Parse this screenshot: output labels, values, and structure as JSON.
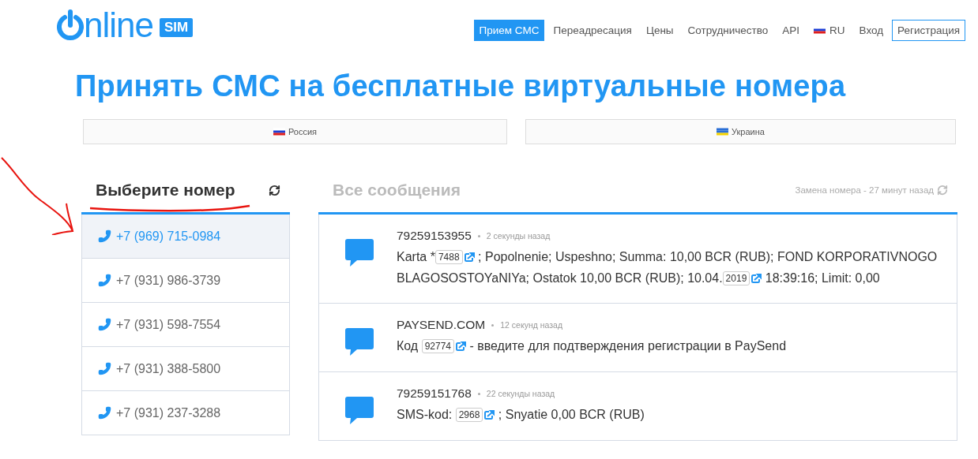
{
  "logo": {
    "text": "nline",
    "badge": "SIM"
  },
  "nav": [
    {
      "label": "Прием СМС",
      "kind": "link",
      "selected": true
    },
    {
      "label": "Переадресация",
      "kind": "link",
      "selected": false
    },
    {
      "label": "Цены",
      "kind": "link",
      "selected": false
    },
    {
      "label": "Сотрудничество",
      "kind": "link",
      "selected": false
    },
    {
      "label": "API",
      "kind": "link",
      "selected": false
    },
    {
      "label": "RU",
      "kind": "lang",
      "selected": false
    },
    {
      "label": "Вход",
      "kind": "link",
      "selected": false
    },
    {
      "label": "Регистрация",
      "kind": "outline",
      "selected": false
    }
  ],
  "title": "Принять СМС на бесплатные виртуальные номера",
  "countries": [
    {
      "label": "Россия",
      "kind": "ru"
    },
    {
      "label": "Украина",
      "kind": "ua"
    }
  ],
  "numbers": {
    "heading": "Выберите номер",
    "items": [
      {
        "phone": "+7 (969) 715-0984",
        "selected": true
      },
      {
        "phone": "+7 (931) 986-3739",
        "selected": false
      },
      {
        "phone": "+7 (931) 598-7554",
        "selected": false
      },
      {
        "phone": "+7 (931) 388-5800",
        "selected": false
      },
      {
        "phone": "+7 (931) 237-3288",
        "selected": false
      }
    ]
  },
  "messages": {
    "heading": "Все сообщения",
    "status": "Замена номера - 27 минут назад",
    "items": [
      {
        "sender": "79259153955",
        "time": "2 секунды назад",
        "parts": [
          {
            "kind": "text",
            "text": "Karta *"
          },
          {
            "kind": "code",
            "text": "7488"
          },
          {
            "kind": "text",
            "text": " ; Popolnenie; Uspeshno; Summa: 10,00 BCR (RUB); FOND KORPORATIVNOGO BLAGOSOSTOYaNIYa; Ostatok 10,00 BCR (RUB); 10.04."
          },
          {
            "kind": "code",
            "text": "2019"
          },
          {
            "kind": "text",
            "text": " 18:39:16; Limit: 0,00"
          }
        ]
      },
      {
        "sender": "PAYSEND.COM",
        "time": "12 секунд назад",
        "parts": [
          {
            "kind": "text",
            "text": "Код "
          },
          {
            "kind": "code",
            "text": "92774"
          },
          {
            "kind": "text",
            "text": " - введите для подтверждения регистрации в PaySend"
          }
        ]
      },
      {
        "sender": "79259151768",
        "time": "22 секунды назад",
        "parts": [
          {
            "kind": "text",
            "text": "SMS-kod: "
          },
          {
            "kind": "code",
            "text": "2968"
          },
          {
            "kind": "text",
            "text": " ; Snyatie 0,00 BCR (RUB)"
          }
        ]
      }
    ]
  }
}
